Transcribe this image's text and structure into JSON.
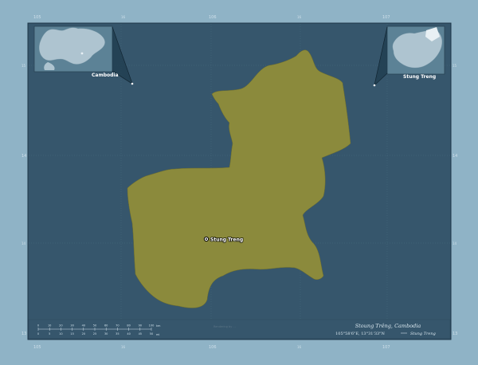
{
  "colors": {
    "outer_bg": "#8fb3c6",
    "map_bg": "#36566c",
    "region_fill": "#8b8a3c",
    "border": "#1c3446",
    "grid": "#4f7287"
  },
  "axes": {
    "top": [
      "105",
      "16",
      "106",
      "16",
      "107"
    ],
    "bottom": [
      "105",
      "16",
      "106",
      "16",
      "107"
    ],
    "left": [
      "15",
      "14",
      "14",
      "13"
    ],
    "right": [
      "15",
      "14",
      "14",
      "13"
    ],
    "left_edge_extra": "13",
    "right_edge_extra": "13"
  },
  "inset_world": {
    "label": "Cambodia"
  },
  "inset_country": {
    "label": "Stung Treng"
  },
  "city": {
    "label": "Stung Treng",
    "icon": "city-marker-icon"
  },
  "footer": {
    "title": "Stoung Trêng, Cambodia",
    "coords": "105°58'6\"E, 13°31'33\"N",
    "legend_label": "Stung Treng",
    "credit": "Rendering by ...",
    "scale_numbers": [
      "0",
      "10",
      "20",
      "30",
      "40",
      "50",
      "60",
      "70",
      "80",
      "90",
      "100"
    ],
    "scale_numbers_bottom": [
      "0",
      "5",
      "10",
      "15",
      "20",
      "25",
      "30",
      "35",
      "40",
      "45",
      "50"
    ],
    "scale_unit_top": "km",
    "scale_unit_bottom": "mi"
  }
}
